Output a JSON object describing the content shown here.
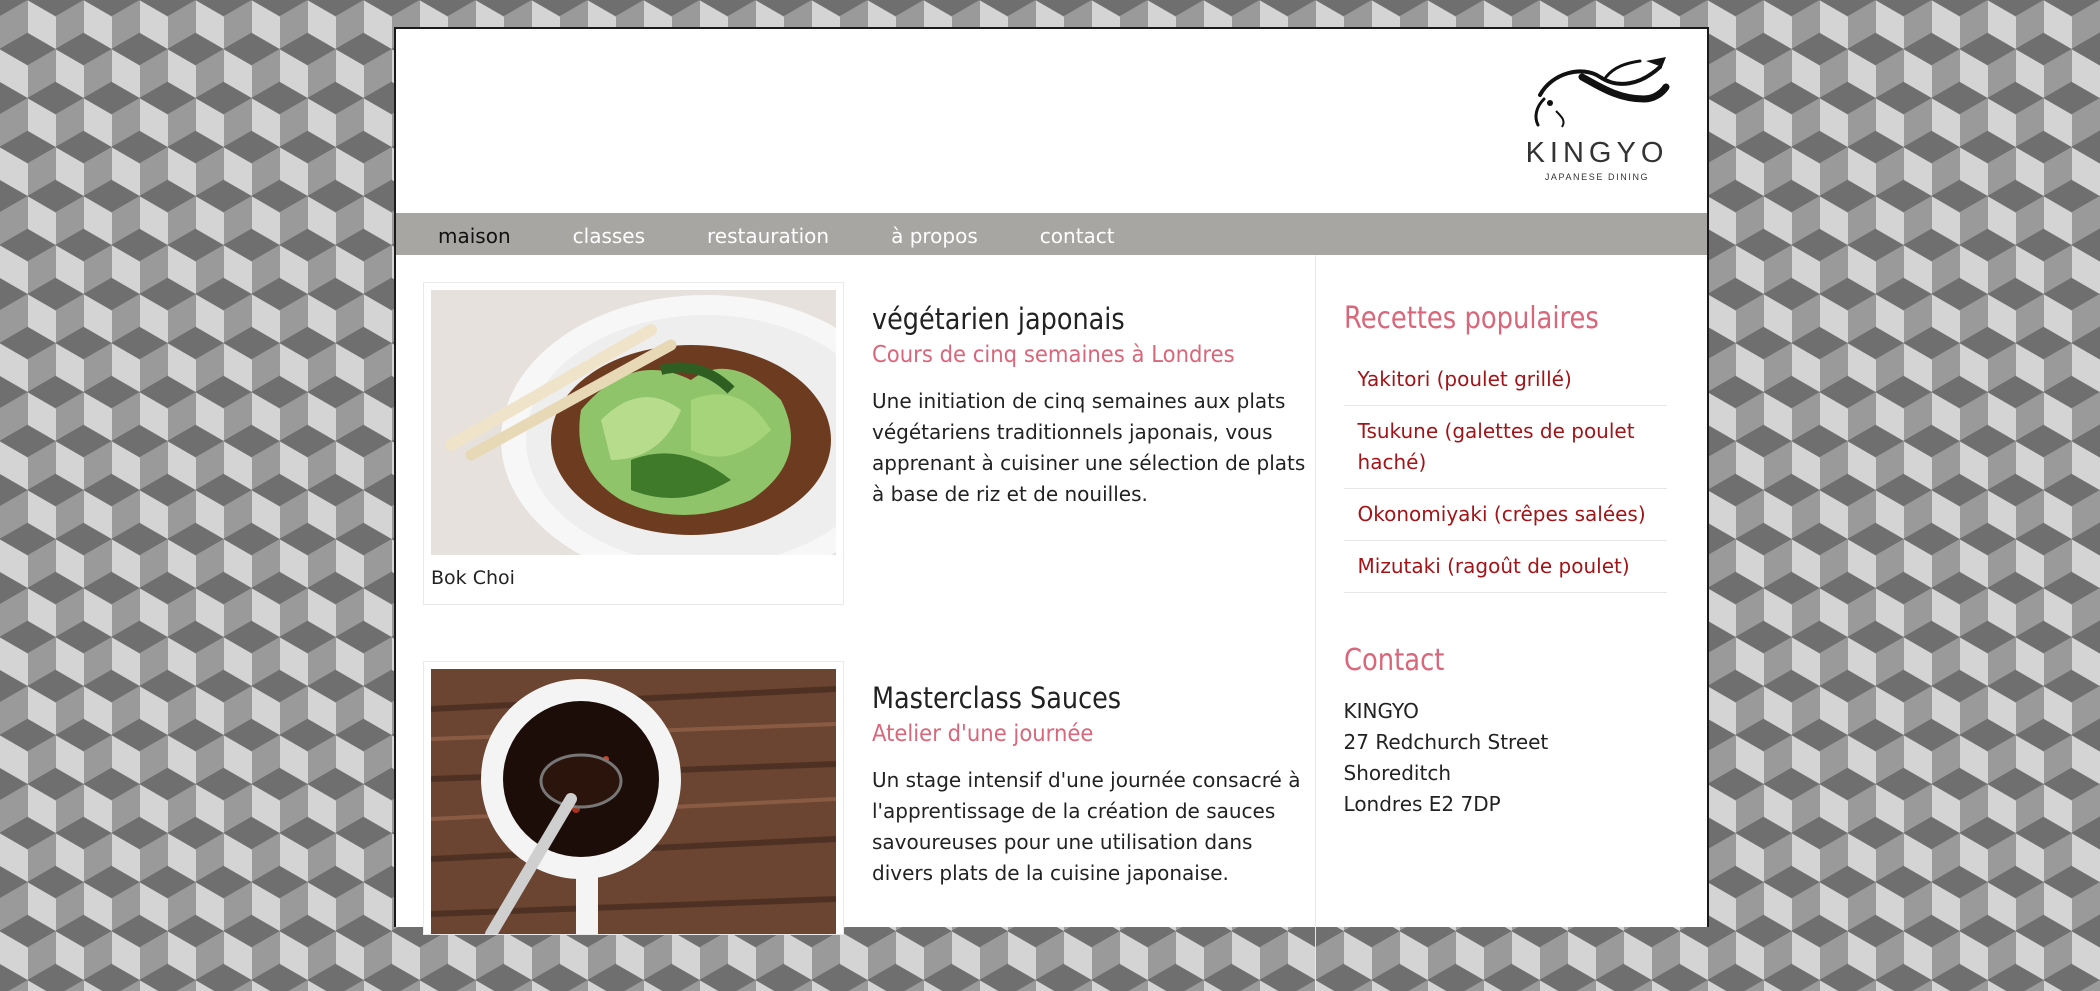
{
  "brand": {
    "name": "KINGYO",
    "tagline": "JAPANESE DINING"
  },
  "nav": {
    "items": [
      {
        "label": "maison",
        "active": true
      },
      {
        "label": "classes",
        "active": false
      },
      {
        "label": "restauration",
        "active": false
      },
      {
        "label": "à propos",
        "active": false
      },
      {
        "label": "contact",
        "active": false
      }
    ]
  },
  "entries": [
    {
      "caption": "Bok Choi",
      "title": "végétarien japonais",
      "subtitle": "Cours de cinq semaines à Londres",
      "description": "Une initiation de cinq semaines aux plats végétariens traditionnels japonais, vous apprenant à cuisiner une sélection de plats à base de riz et de nouilles."
    },
    {
      "caption": "",
      "title": "Masterclass Sauces",
      "subtitle": "Atelier d'une journée",
      "description": "Un stage intensif d'une journée consacré à l'apprentissage de la création de sauces savoureuses pour une utilisation dans divers plats de la cuisine japonaise."
    }
  ],
  "sidebar": {
    "recipes_title": "Recettes populaires",
    "recipes": [
      "Yakitori (poulet grillé)",
      "Tsukune (galettes de poulet haché)",
      "Okonomiyaki (crêpes salées)",
      "Mizutaki (ragoût de poulet)"
    ],
    "contact_title": "Contact",
    "address": [
      "KINGYO",
      "27 Redchurch Street",
      "Shoreditch",
      "Londres E2 7DP"
    ]
  },
  "colors": {
    "accent": "#d9667a",
    "link": "#a31418",
    "nav_bg": "#a8a6a2"
  }
}
